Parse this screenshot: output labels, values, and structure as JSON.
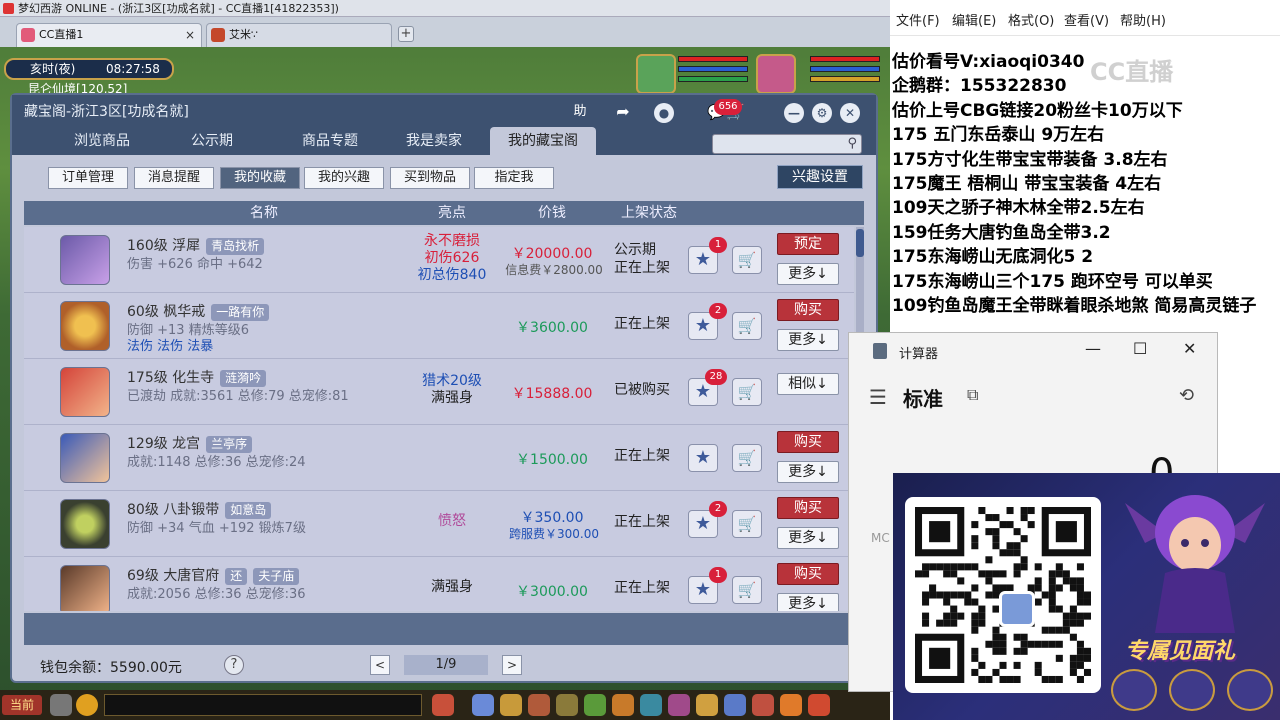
{
  "browser": {
    "title": "梦幻西游 ONLINE - (浙江3区[功成名就] - CC直播1[41822353])",
    "tabs": [
      {
        "label": "CC直播1",
        "close": "×"
      },
      {
        "label": "艾米∵",
        "close": ""
      }
    ],
    "add_tab": "+"
  },
  "game": {
    "clock_time": "亥时(夜)",
    "clock_hms": "08:27:58",
    "location": "昆仑仙境[120,52]"
  },
  "panel": {
    "title": "藏宝阁-浙江3区[功成名就]",
    "help_label": "助",
    "msg_badge": "656",
    "nav_tabs": [
      "浏览商品",
      "公示期",
      "商品专题",
      "我是卖家",
      "我的藏宝阁"
    ],
    "active_tab": 4,
    "sub_buttons": [
      "订单管理",
      "消息提醒",
      "我的收藏",
      "我的兴趣",
      "买到物品",
      "指定我"
    ],
    "active_sub": 2,
    "interest_settings": "兴趣设置",
    "columns": {
      "name": "名称",
      "highlight": "亮点",
      "price": "价钱",
      "status": "上架状态"
    },
    "rows": [
      {
        "name": "160级 浮犀",
        "tag": "青岛找析",
        "tag2": "",
        "stats": "伤害 +626 命中 +642",
        "stats2": "",
        "hl": [
          "永不磨损",
          "初伤626",
          "初总伤840"
        ],
        "price": "￥20000.00",
        "fee": "信息费￥2800.00",
        "status": [
          "公示期",
          "正在上架"
        ],
        "star_badge": "1",
        "act1": "预定",
        "act2": "更多↓"
      },
      {
        "name": "60级 枫华戒",
        "tag": "一路有你",
        "tag2": "",
        "stats": "防御 +13 精炼等级6",
        "stats2": "法伤 法伤 法暴",
        "hl": [],
        "price": "￥3600.00",
        "fee": "",
        "status": [
          "正在上架"
        ],
        "star_badge": "2",
        "act1": "购买",
        "act2": "更多↓"
      },
      {
        "name": "175级 化生寺",
        "tag": "涟漪吟",
        "tag2": "",
        "stats": "已渡劫 成就:3561 总修:79 总宠修:81",
        "stats2": "",
        "hl": [
          "猎术20级",
          "满强身"
        ],
        "price": "￥15888.00",
        "fee": "",
        "status": [
          "已被购买"
        ],
        "star_badge": "28",
        "act1": "",
        "act2": "相似↓"
      },
      {
        "name": "129级 龙宫",
        "tag": "兰亭序",
        "tag2": "",
        "stats": "成就:1148 总修:36 总宠修:24",
        "stats2": "",
        "hl": [],
        "price": "￥1500.00",
        "fee": "",
        "status": [
          "正在上架"
        ],
        "star_badge": "",
        "act1": "购买",
        "act2": "更多↓"
      },
      {
        "name": "80级 八卦锻带",
        "tag": "如意岛",
        "tag2": "",
        "stats": "防御 +34 气血 +192 锻炼7级",
        "stats2": "",
        "hl": [
          "愤怒"
        ],
        "price": "￥350.00",
        "fee": "跨服费￥300.00",
        "status": [
          "正在上架"
        ],
        "star_badge": "2",
        "act1": "购买",
        "act2": "更多↓"
      },
      {
        "name": "69级 大唐官府",
        "tag": "还",
        "tag2": "夫子庙",
        "stats": "成就:2056 总修:36 总宠修:36",
        "stats2": "",
        "hl": [
          "满强身"
        ],
        "price": "￥3000.00",
        "fee": "",
        "status": [
          "正在上架"
        ],
        "star_badge": "1",
        "act1": "购买",
        "act2": "更多↓"
      }
    ],
    "wallet": "钱包余额：5590.00元",
    "help_q": "?",
    "page": "1/9",
    "prev": "<",
    "next": ">"
  },
  "chat": {
    "now": "当前"
  },
  "notepad": {
    "menu": [
      "文件(F)",
      "编辑(E)",
      "格式(O)",
      "查看(V)",
      "帮助(H)"
    ],
    "lines": [
      "估价看号V:xiaoqi0340",
      "企鹅群：155322830",
      "估价上号CBG链接20粉丝卡10万以下",
      "175 五门东岳泰山  9万左右",
      "175方寸化生带宝宝带装备  3.8左右",
      "175魔王 梧桐山  带宝宝装备 4左右",
      "109天之骄子神木林全带2.5左右",
      "159任务大唐钓鱼岛全带3.2",
      "175东海崂山无底洞化5  2",
      "175东海崂山三个175 跑环空号 可以单买",
      "109钓鱼岛魔王全带眯着眼杀地煞 简易高灵链子"
    ],
    "watermark": "CC直播"
  },
  "calculator": {
    "title": "计算器",
    "mode": "标准",
    "display": "0",
    "memory_label": "MC",
    "minimize": "—",
    "maximize": "☐",
    "close": "✕"
  },
  "promo": {
    "text": "专属见面礼"
  },
  "colors": {
    "red_price": "#d8203a",
    "green_price": "#1c9a5a",
    "blue_price": "#1e4fb4",
    "panel_head": "#3d5170"
  }
}
